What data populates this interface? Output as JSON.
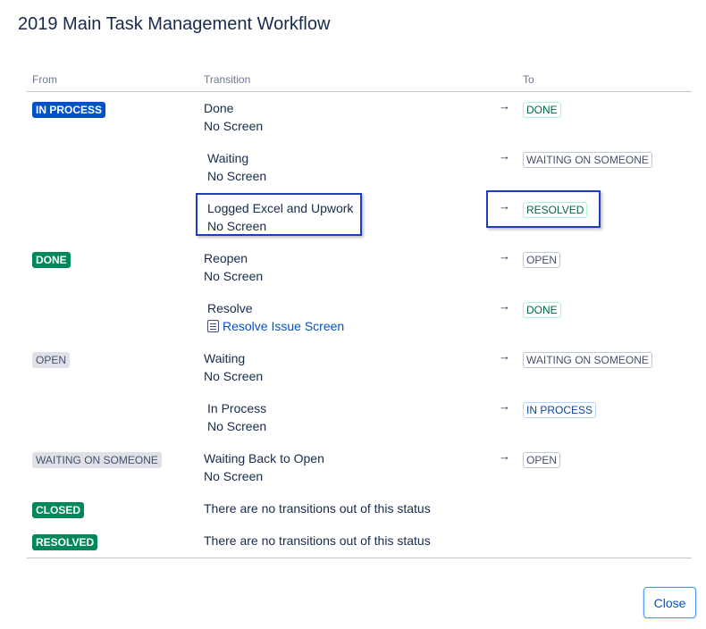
{
  "dialog": {
    "title": "2019 Main Task Management Workflow",
    "close_label": "Close"
  },
  "headers": {
    "from": "From",
    "transition": "Transition",
    "to": "To"
  },
  "arrow": "→",
  "rows": [
    {
      "from": "IN PROCESS",
      "transition": "Done",
      "screen": "No Screen",
      "to": "DONE"
    },
    {
      "transition": "Waiting",
      "screen": "No Screen",
      "to": "WAITING ON SOMEONE"
    },
    {
      "transition": "Logged Excel and Upwork",
      "screen": "No Screen",
      "to": "RESOLVED"
    },
    {
      "from": "DONE",
      "transition": "Reopen",
      "screen": "No Screen",
      "to": "OPEN"
    },
    {
      "transition": "Resolve",
      "screen": "Resolve Issue Screen",
      "to": "DONE"
    },
    {
      "from": "OPEN",
      "transition": "Waiting",
      "screen": "No Screen",
      "to": "WAITING ON SOMEONE"
    },
    {
      "transition": "In Process",
      "screen": "No Screen",
      "to": "IN PROCESS"
    },
    {
      "from": "WAITING ON SOMEONE",
      "transition": "Waiting Back to Open",
      "screen": "No Screen",
      "to": "OPEN"
    },
    {
      "from": "CLOSED",
      "transition": "There are no transitions out of this status"
    },
    {
      "from": "RESOLVED",
      "transition": "There are no transitions out of this status"
    }
  ],
  "colors": {
    "in_process": "#0052cc",
    "done": "#00875a",
    "neutral": "#dfe1e6",
    "highlight_box": "#1f3cbf",
    "link": "#0052cc"
  },
  "icons": {
    "screen": "screen-doc-icon",
    "arrow": "right-arrow-icon"
  }
}
